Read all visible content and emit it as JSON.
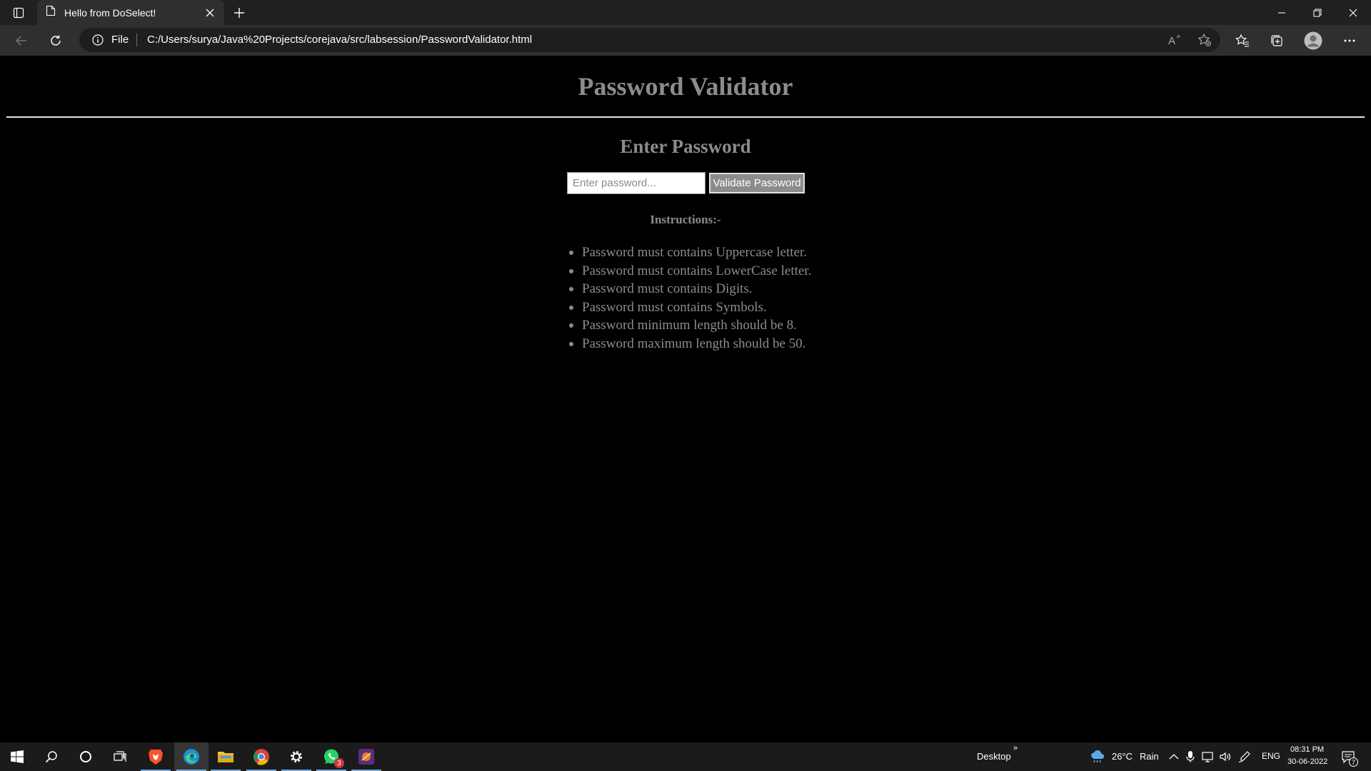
{
  "browser": {
    "tab_title": "Hello from DoSelect!",
    "address_prefix": "File",
    "url": "C:/Users/surya/Java%20Projects/corejava/src/labsession/PasswordValidator.html"
  },
  "page": {
    "title": "Password Validator",
    "subtitle": "Enter Password",
    "input_placeholder": "Enter password...",
    "button_label": "Validate Password",
    "instructions_heading": "Instructions:-",
    "instructions": [
      "Password must contains Uppercase letter.",
      "Password must contains LowerCase letter.",
      "Password must contains Digits.",
      "Password must contains Symbols.",
      "Password minimum length should be 8.",
      "Password maximum length should be 50."
    ]
  },
  "taskbar": {
    "desktop_label": "Desktop",
    "whatsapp_badge": "3",
    "weather_temp": "26°C",
    "weather_desc": "Rain",
    "language": "ENG",
    "time": "08:31 PM",
    "date": "30-06-2022",
    "notification_count": "7"
  },
  "colors": {
    "page_text": "#8c8c8c",
    "chrome_bg": "#202020",
    "toolbar_bg": "#2f2f2f",
    "taskbar_bg": "#1b1b1b"
  }
}
